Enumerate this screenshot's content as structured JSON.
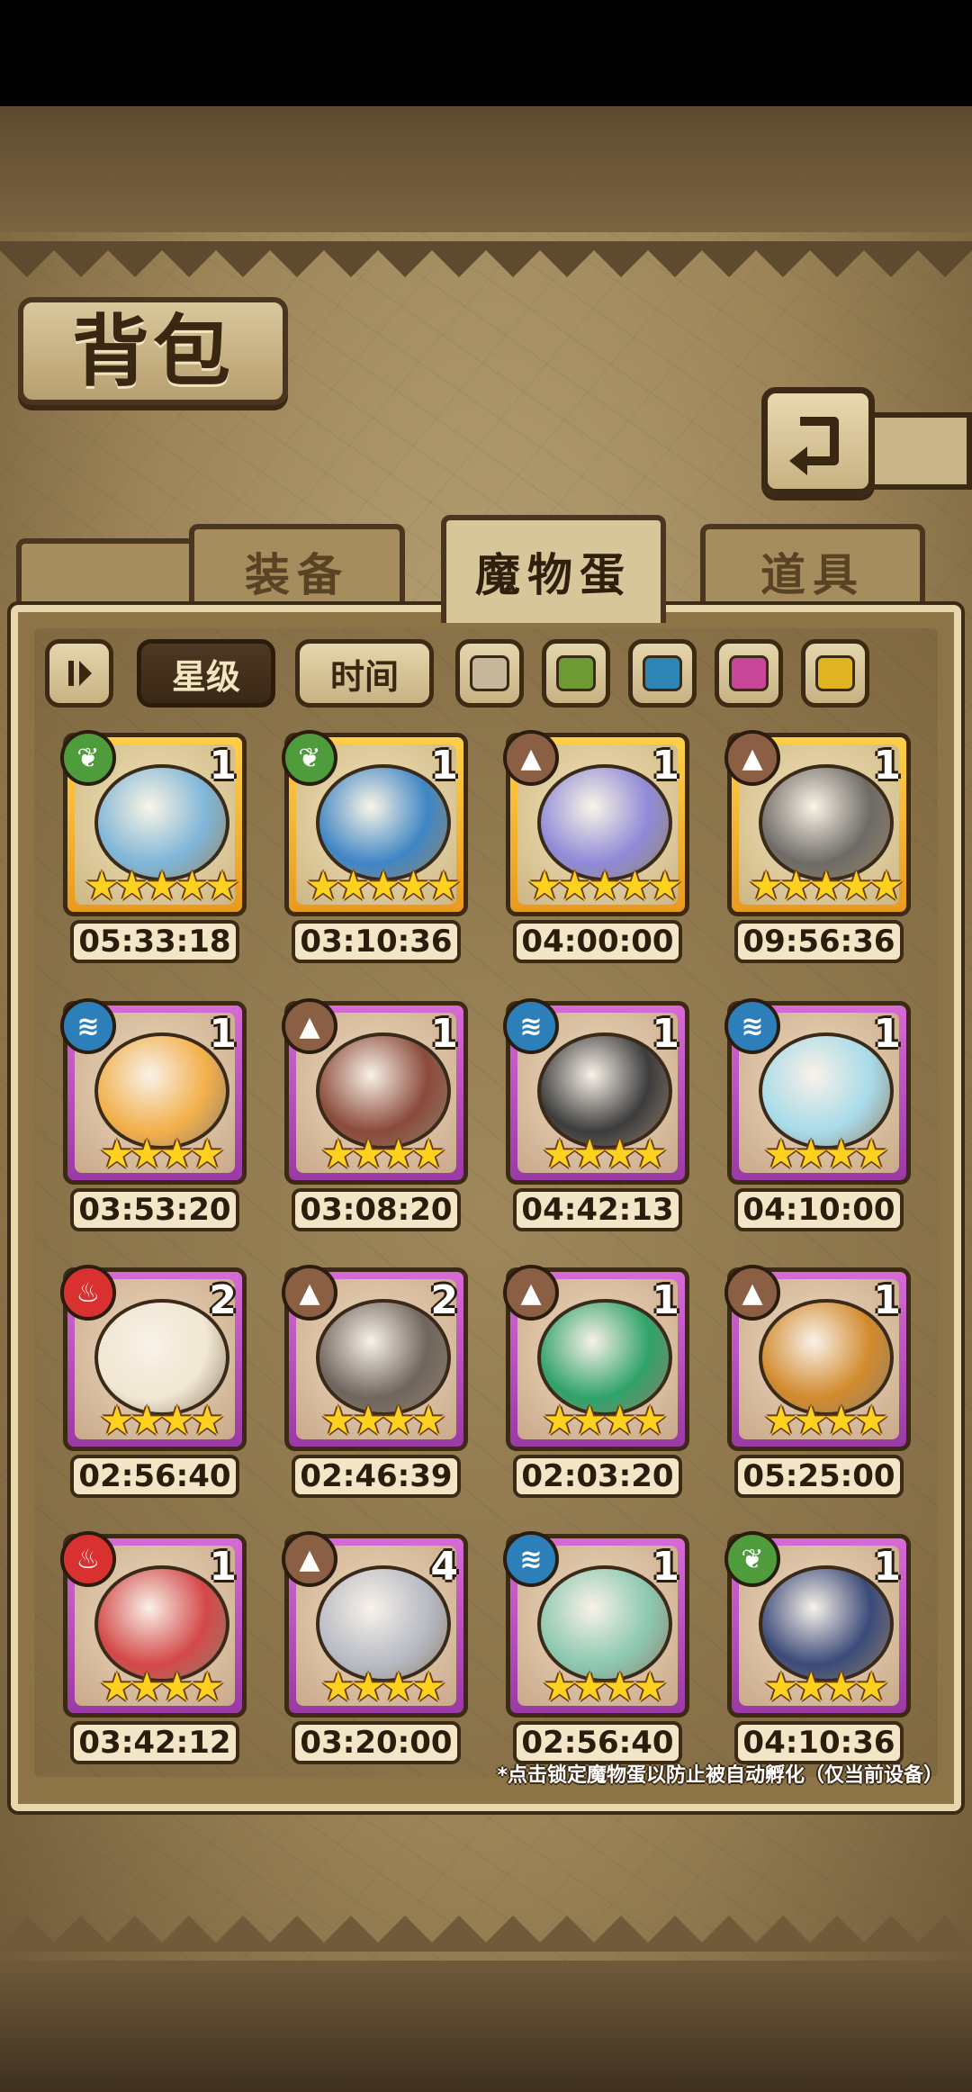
{
  "title": "背包",
  "tabs": [
    {
      "label": "装备",
      "active": false
    },
    {
      "label": "魔物蛋",
      "active": true
    },
    {
      "label": "道具",
      "active": false
    }
  ],
  "filters": {
    "sort_star_label": "星级",
    "sort_time_label": "时间",
    "active_sort": "星级",
    "color_swatches": [
      "#c6b89b",
      "#6d9a32",
      "#2f86b6",
      "#c64698",
      "#e0b322"
    ]
  },
  "items": [
    {
      "element": "grass",
      "count": "1",
      "stars": 5,
      "rarity": "gold",
      "timer": "05:33:18"
    },
    {
      "element": "grass",
      "count": "1",
      "stars": 5,
      "rarity": "gold",
      "timer": "03:10:36"
    },
    {
      "element": "earth",
      "count": "1",
      "stars": 5,
      "rarity": "gold",
      "timer": "04:00:00"
    },
    {
      "element": "earth",
      "count": "1",
      "stars": 5,
      "rarity": "gold",
      "timer": "09:56:36"
    },
    {
      "element": "water",
      "count": "1",
      "stars": 4,
      "rarity": "purple",
      "timer": "03:53:20"
    },
    {
      "element": "earth",
      "count": "1",
      "stars": 4,
      "rarity": "purple",
      "timer": "03:08:20"
    },
    {
      "element": "water",
      "count": "1",
      "stars": 4,
      "rarity": "purple",
      "timer": "04:42:13"
    },
    {
      "element": "water",
      "count": "1",
      "stars": 4,
      "rarity": "purple",
      "timer": "04:10:00"
    },
    {
      "element": "fire",
      "count": "2",
      "stars": 4,
      "rarity": "purple",
      "timer": "02:56:40"
    },
    {
      "element": "earth",
      "count": "2",
      "stars": 4,
      "rarity": "purple",
      "timer": "02:46:39"
    },
    {
      "element": "earth",
      "count": "1",
      "stars": 4,
      "rarity": "purple",
      "timer": "02:03:20"
    },
    {
      "element": "earth",
      "count": "1",
      "stars": 4,
      "rarity": "purple",
      "timer": "05:25:00"
    },
    {
      "element": "fire",
      "count": "1",
      "stars": 4,
      "rarity": "purple",
      "timer": "03:42:12"
    },
    {
      "element": "earth",
      "count": "4",
      "stars": 4,
      "rarity": "purple",
      "timer": "03:20:00"
    },
    {
      "element": "water",
      "count": "1",
      "stars": 4,
      "rarity": "purple",
      "timer": "02:56:40"
    },
    {
      "element": "grass",
      "count": "1",
      "stars": 4,
      "rarity": "purple",
      "timer": "04:10:36"
    }
  ],
  "hint": "*点击锁定魔物蛋以防止被自动孵化（仅当前设备）"
}
